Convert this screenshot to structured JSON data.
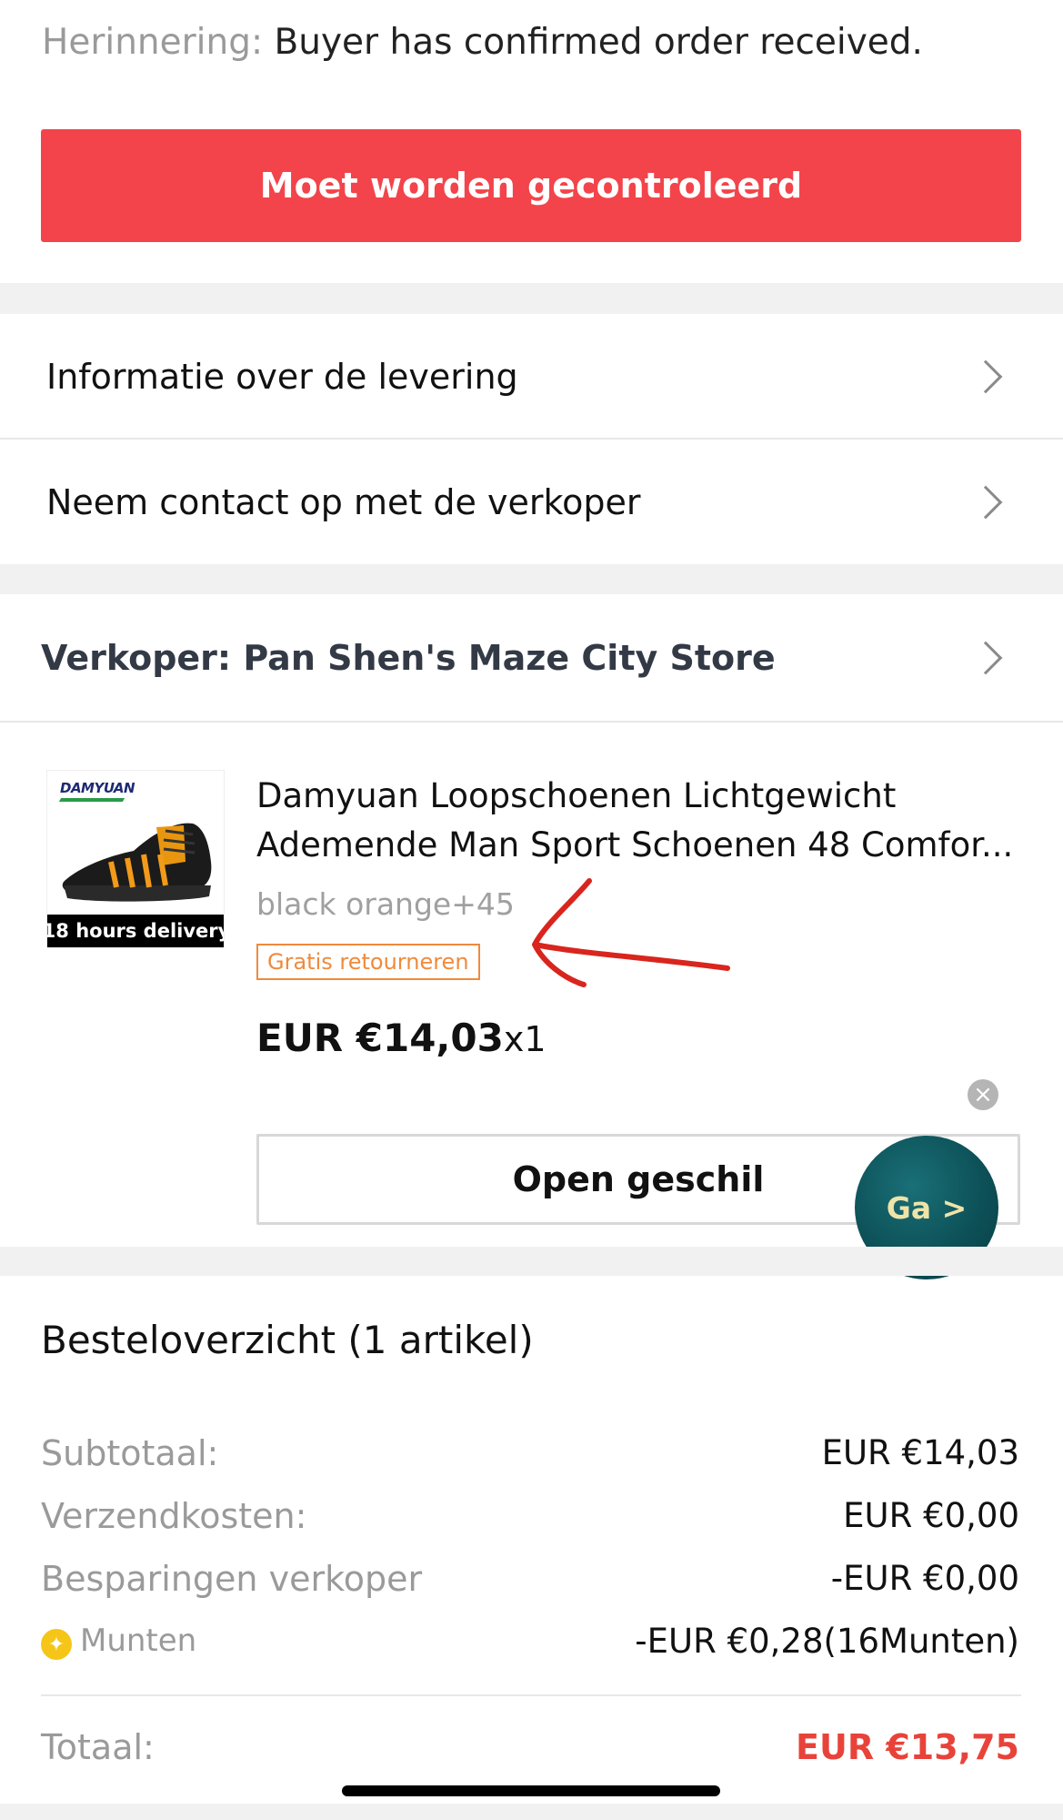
{
  "reminder": {
    "label": "Herinnering:",
    "text": " Buyer has confirmed order received."
  },
  "primary_action": {
    "label": "Moet worden gecontroleerd",
    "color": "#f2444a"
  },
  "menu": {
    "delivery_info": "Informatie over de levering",
    "contact_seller": "Neem contact op met de verkoper"
  },
  "seller": {
    "label": "Verkoper: Pan Shen's Maze City Store"
  },
  "product": {
    "thumb_brand": "DAMYUAN",
    "thumb_badge": "18 hours delivery",
    "title_line1": "Damyuan Loopschoenen Lichtgewicht",
    "title_line2": "Ademende Man Sport Schoenen 48 Comfor...",
    "variant": "black orange+45",
    "return_badge": "Gratis retourneren",
    "price": "EUR €14,03",
    "quantity": "x1",
    "dispute_button": "Open geschil",
    "go_button": "Ga >",
    "close_icon": "close-icon"
  },
  "summary": {
    "title": "Besteloverzicht (1 artikel)",
    "rows": [
      {
        "label": "Subtotaal:",
        "value": "EUR €14,03"
      },
      {
        "label": "Verzendkosten:",
        "value": "EUR €0,00"
      },
      {
        "label": "Besparingen verkoper",
        "value": "-EUR €0,00"
      },
      {
        "label": "Munten",
        "value": "-EUR €0,28(16Munten)"
      }
    ],
    "total_label": "Totaal:",
    "total_value": "EUR €13,75",
    "total_color": "#e8433a"
  }
}
